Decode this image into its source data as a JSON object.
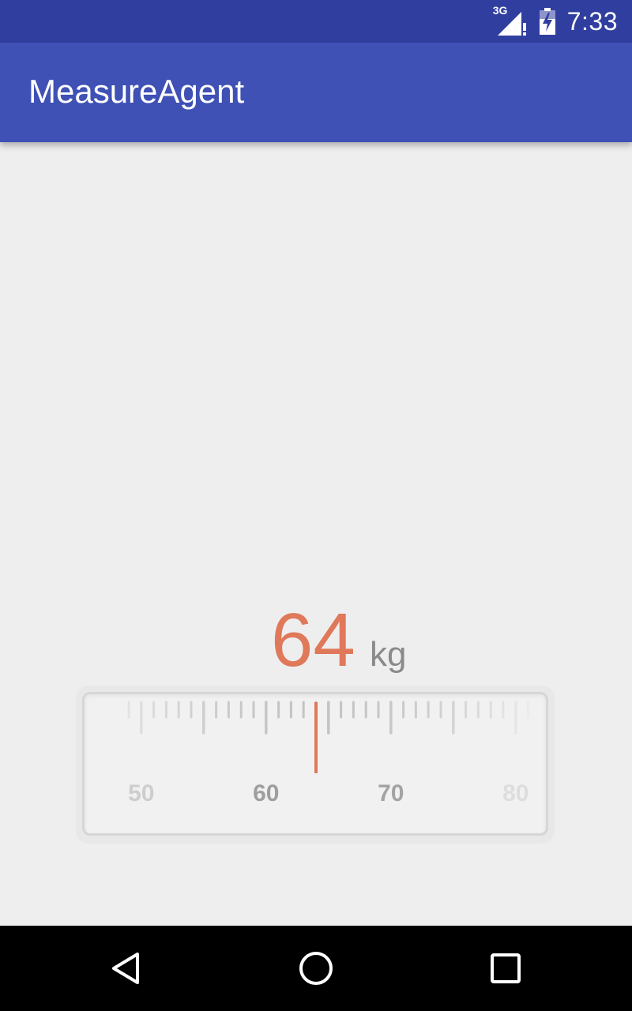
{
  "status_bar": {
    "network_label": "3G",
    "time": "7:33",
    "icons": [
      "signal-icon",
      "battery-charging-icon"
    ]
  },
  "app_bar": {
    "title": "MeasureAgent"
  },
  "measurement": {
    "value": "64",
    "unit": "kg"
  },
  "ruler": {
    "min": 49,
    "max": 81,
    "current": 64,
    "labels": [
      "50",
      "60",
      "70",
      "80"
    ],
    "accent_color": "#e0785a"
  },
  "nav_bar": {
    "icons": [
      "back-icon",
      "home-icon",
      "recents-icon"
    ]
  },
  "colors": {
    "status_bar": "#303f9f",
    "app_bar": "#3f51b5",
    "background": "#eeeeee",
    "accent": "#e0785a"
  }
}
